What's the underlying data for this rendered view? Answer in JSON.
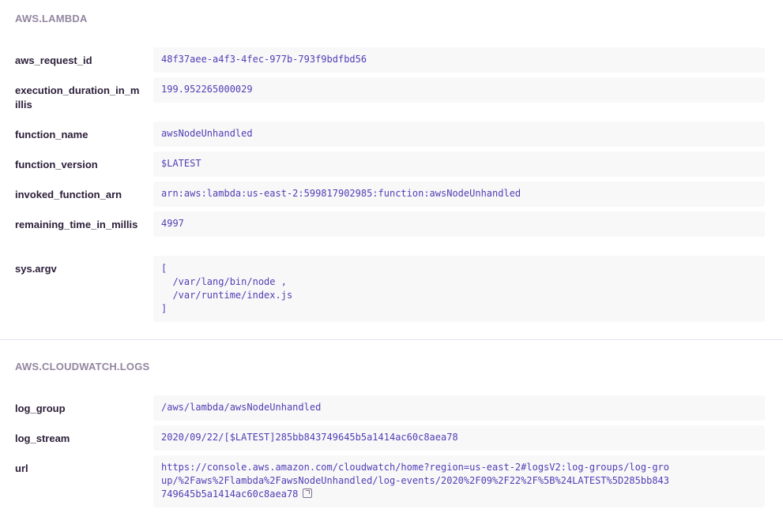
{
  "lambda_section": {
    "title": "AWS.LAMBDA",
    "rows": [
      {
        "key": "aws_request_id",
        "value": "48f37aee-a4f3-4fec-977b-793f9bdfbd56"
      },
      {
        "key": "execution_duration_in_millis",
        "value": "199.952265000029"
      },
      {
        "key": "function_name",
        "value": "awsNodeUnhandled"
      },
      {
        "key": "function_version",
        "value": "$LATEST"
      },
      {
        "key": "invoked_function_arn",
        "value": "arn:aws:lambda:us-east-2:599817902985:function:awsNodeUnhandled"
      },
      {
        "key": "remaining_time_in_millis",
        "value": "4997"
      },
      {
        "key": "sys.argv",
        "value": "[\n  /var/lang/bin/node ,\n  /var/runtime/index.js\n]"
      }
    ]
  },
  "cloudwatch_section": {
    "title": "AWS.CLOUDWATCH.LOGS",
    "rows": [
      {
        "key": "log_group",
        "value": "/aws/lambda/awsNodeUnhandled"
      },
      {
        "key": "log_stream",
        "value": "2020/09/22/[$LATEST]285bb843749645b5a1414ac60c8aea78"
      },
      {
        "key": "url",
        "value": "https://console.aws.amazon.com/cloudwatch/home?region=us-east-2#logsV2:log-groups/log-group/%2Faws%2Flambda%2FawsNodeUnhandled/log-events/2020%2F09%2F22%2F%5B%24LATEST%5D285bb843749645b5a1414ac60c8aea78"
      }
    ]
  },
  "icons": {
    "url_link": "external-link-icon"
  }
}
